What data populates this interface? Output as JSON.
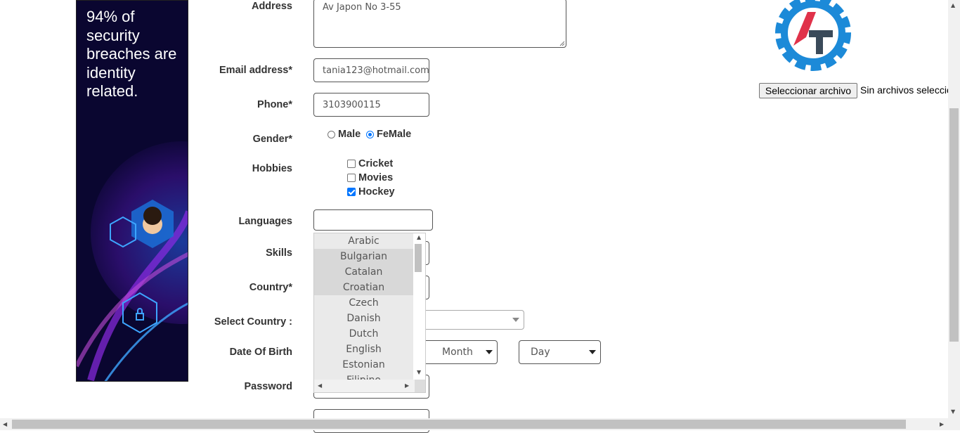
{
  "ad": {
    "headline": "94% of security breaches are identity related."
  },
  "form": {
    "address": {
      "label": "Address",
      "value": "Av Japon No 3-55"
    },
    "email": {
      "label": "Email address*",
      "value": "tania123@hotmail.com"
    },
    "phone": {
      "label": "Phone*",
      "value": "3103900115"
    },
    "gender": {
      "label": "Gender*",
      "options": [
        "Male",
        "FeMale"
      ],
      "selected": "FeMale"
    },
    "hobbies": {
      "label": "Hobbies",
      "options": [
        {
          "label": "Cricket",
          "checked": false
        },
        {
          "label": "Movies",
          "checked": false
        },
        {
          "label": "Hockey",
          "checked": true
        }
      ]
    },
    "languages": {
      "label": "Languages",
      "value": "",
      "options": [
        "Arabic",
        "Bulgarian",
        "Catalan",
        "Croatian",
        "Czech",
        "Danish",
        "Dutch",
        "English",
        "Estonian",
        "Filipino"
      ]
    },
    "skills": {
      "label": "Skills"
    },
    "country": {
      "label": "Country*"
    },
    "select_country": {
      "label": "Select Country :"
    },
    "dob": {
      "label": "Date Of Birth",
      "month_placeholder": "Month",
      "day_placeholder": "Day"
    },
    "password": {
      "label": "Password"
    }
  },
  "file": {
    "button_label": "Seleccionar archivo",
    "status": "Sin archivos seleccionados"
  },
  "colors": {
    "ad_bg": "#0a0630",
    "logo_blue": "#1c8ad8",
    "logo_red": "#e0324a",
    "logo_dark": "#3a4a5a",
    "accent": "#0075ff"
  },
  "icons": [
    "gear-logo-icon",
    "resize-grip-icon",
    "scroll-up-arrow-icon",
    "scroll-down-arrow-icon",
    "scroll-left-arrow-icon",
    "scroll-right-arrow-icon",
    "chevron-down-icon"
  ]
}
